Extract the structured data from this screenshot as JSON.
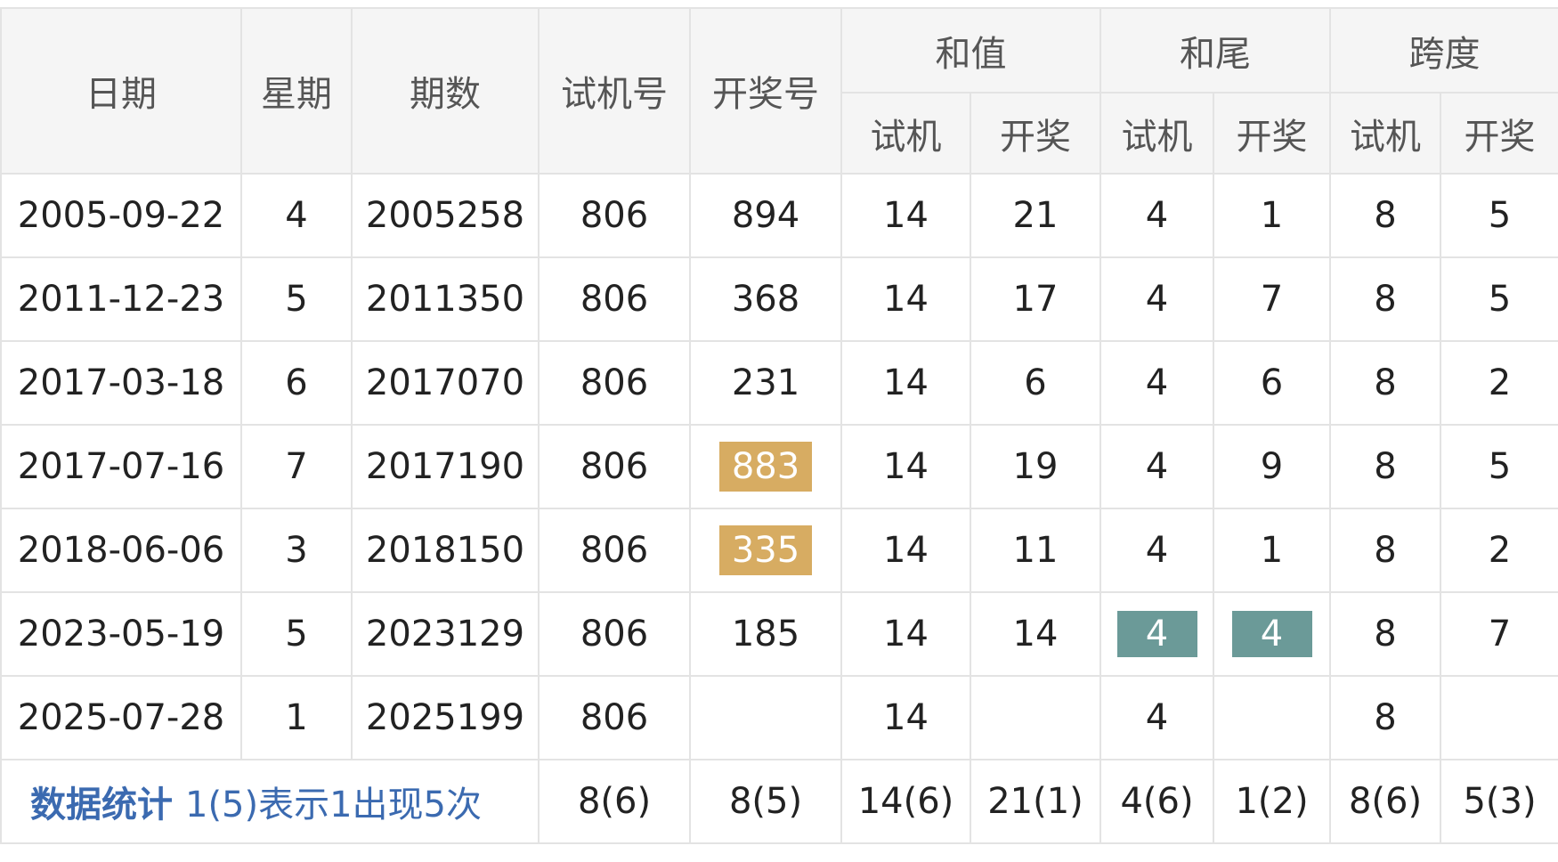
{
  "table": {
    "headers": {
      "date": "日期",
      "weekday": "星期",
      "issue": "期数",
      "trial_number": "试机号",
      "draw_number": "开奖号",
      "sum": "和值",
      "sum_tail": "和尾",
      "span": "跨度",
      "sub_trial": "试机",
      "sub_draw": "开奖"
    },
    "rows": [
      {
        "date": "2005-09-22",
        "weekday": "4",
        "issue": "2005258",
        "trial": "806",
        "draw": "894",
        "sum_trial": "14",
        "sum_draw": "21",
        "tail_trial": "4",
        "tail_draw": "1",
        "span_trial": "8",
        "span_draw": "5"
      },
      {
        "date": "2011-12-23",
        "weekday": "5",
        "issue": "2011350",
        "trial": "806",
        "draw": "368",
        "sum_trial": "14",
        "sum_draw": "17",
        "tail_trial": "4",
        "tail_draw": "7",
        "span_trial": "8",
        "span_draw": "5"
      },
      {
        "date": "2017-03-18",
        "weekday": "6",
        "issue": "2017070",
        "trial": "806",
        "draw": "231",
        "sum_trial": "14",
        "sum_draw": "6",
        "tail_trial": "4",
        "tail_draw": "6",
        "span_trial": "8",
        "span_draw": "2"
      },
      {
        "date": "2017-07-16",
        "weekday": "7",
        "issue": "2017190",
        "trial": "806",
        "draw": "883",
        "sum_trial": "14",
        "sum_draw": "19",
        "tail_trial": "4",
        "tail_draw": "9",
        "span_trial": "8",
        "span_draw": "5"
      },
      {
        "date": "2018-06-06",
        "weekday": "3",
        "issue": "2018150",
        "trial": "806",
        "draw": "335",
        "sum_trial": "14",
        "sum_draw": "11",
        "tail_trial": "4",
        "tail_draw": "1",
        "span_trial": "8",
        "span_draw": "2"
      },
      {
        "date": "2023-05-19",
        "weekday": "5",
        "issue": "2023129",
        "trial": "806",
        "draw": "185",
        "sum_trial": "14",
        "sum_draw": "14",
        "tail_trial": "4",
        "tail_draw": "4",
        "span_trial": "8",
        "span_draw": "7"
      },
      {
        "date": "2025-07-28",
        "weekday": "1",
        "issue": "2025199",
        "trial": "806",
        "draw": "",
        "sum_trial": "14",
        "sum_draw": "",
        "tail_trial": "4",
        "tail_draw": "",
        "span_trial": "8",
        "span_draw": ""
      }
    ],
    "stats": {
      "label": "数据统计",
      "note": "1(5)表示1出现5次",
      "trial": "8(6)",
      "draw": "8(5)",
      "sum_trial": "14(6)",
      "sum_draw": "21(1)",
      "tail_trial": "4(6)",
      "tail_draw": "1(2)",
      "span_trial": "8(6)",
      "span_draw": "5(3)"
    }
  },
  "colors": {
    "draw_red": "#b72a2a",
    "gold_highlight": "#d7ac62",
    "teal_highlight": "#6b9a98",
    "stats_blue": "#3b6ab0",
    "header_bg": "#f5f5f5"
  }
}
